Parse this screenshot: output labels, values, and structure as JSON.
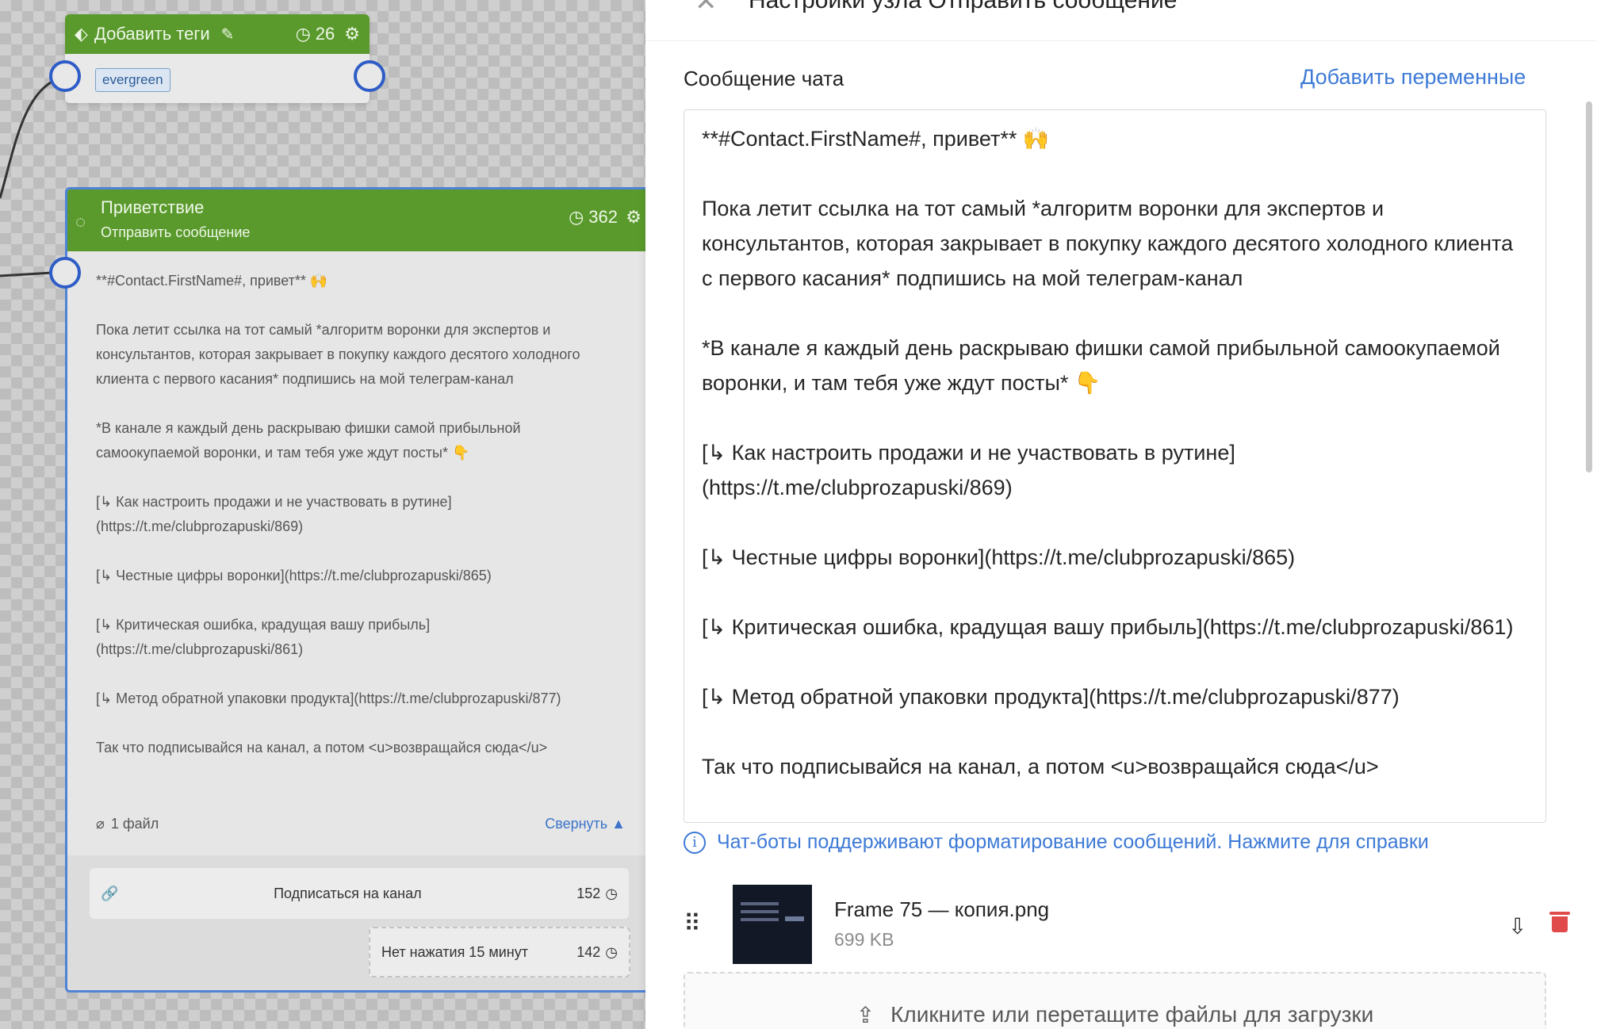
{
  "canvas": {
    "tags_node": {
      "title": "Добавить теги",
      "count": "26",
      "tag": "evergreen"
    },
    "greeting_node": {
      "title": "Приветствие",
      "subtitle": "Отправить сообщение",
      "count": "362",
      "message": "**#Contact.FirstName#, привет** 🙌\n\nПока летит ссылка на тот самый *алгоритм воронки для экспертов и консультантов, которая закрывает в покупку каждого десятого холодного клиента с первого касания* подпишись на мой телеграм-канал\n\n*В канале я каждый день раскрываю фишки самой прибыльной самоокупаемой воронки, и там тебя уже ждут посты* 👇\n\n[↳ Как настроить продажи и не участвовать в рутине](https://t.me/clubprozapuski/869)\n\n[↳ Честные цифры воронки](https://t.me/clubprozapuski/865)\n\n[↳ Критическая ошибка, крадущая вашу прибыль](https://t.me/clubprozapuski/861)\n\n[↳ Метод обратной упаковки продукта](https://t.me/clubprozapuski/877)\n\nТак что подписывайся на канал, а потом <u>возвращайся сюда</u>",
      "files_label": "1 файл",
      "collapse_label": "Свернуть ▲",
      "button": {
        "label": "Подписаться на канал",
        "count": "152"
      },
      "timeout": {
        "label": "Нет нажатия 15 минут",
        "count": "142"
      }
    }
  },
  "panel": {
    "title": "Настройки узла Отправить сообщение",
    "field_label": "Сообщение чата",
    "add_variables": "Добавить переменные",
    "message": "**#Contact.FirstName#, привет** 🙌\n\nПока летит ссылка на тот самый *алгоритм воронки для экспертов и консультантов, которая закрывает в покупку каждого десятого холодного клиента с первого касания* подпишись на мой телеграм-канал\n\n*В канале я каждый день раскрываю фишки самой прибыльной самоокупаемой воронки, и там тебя уже ждут посты* 👇\n\n[↳ Как настроить продажи и не участвовать в рутине](https://t.me/clubprozapuski/869)\n\n[↳ Честные цифры воронки](https://t.me/clubprozapuski/865)\n\n[↳ Критическая ошибка, крадущая вашу прибыль](https://t.me/clubprozapuski/861)\n\n[↳ Метод обратной упаковки продукта](https://t.me/clubprozapuski/877)\n\nТак что подписывайся на канал, а потом <u>возвращайся сюда</u>",
    "hint": "Чат-боты поддерживают форматирование сообщений. Нажмите для справки",
    "file": {
      "name": "Frame 75 — копия.png",
      "size": "699 KB"
    },
    "dropzone": "Кликните или перетащите файлы для загрузки"
  },
  "colors": {
    "node_header": "#5a9a2c",
    "port": "#2f5dc7",
    "accent_link": "#3d7ad6",
    "delete": "#e04a4a"
  },
  "icons": [
    "tag-icon",
    "pencil-icon",
    "clock-icon",
    "gear-icon",
    "chat-icon",
    "paperclip-icon",
    "link-icon",
    "close-icon",
    "info-icon",
    "drag-handle-icon",
    "download-cloud-icon",
    "trash-icon",
    "upload-icon"
  ]
}
